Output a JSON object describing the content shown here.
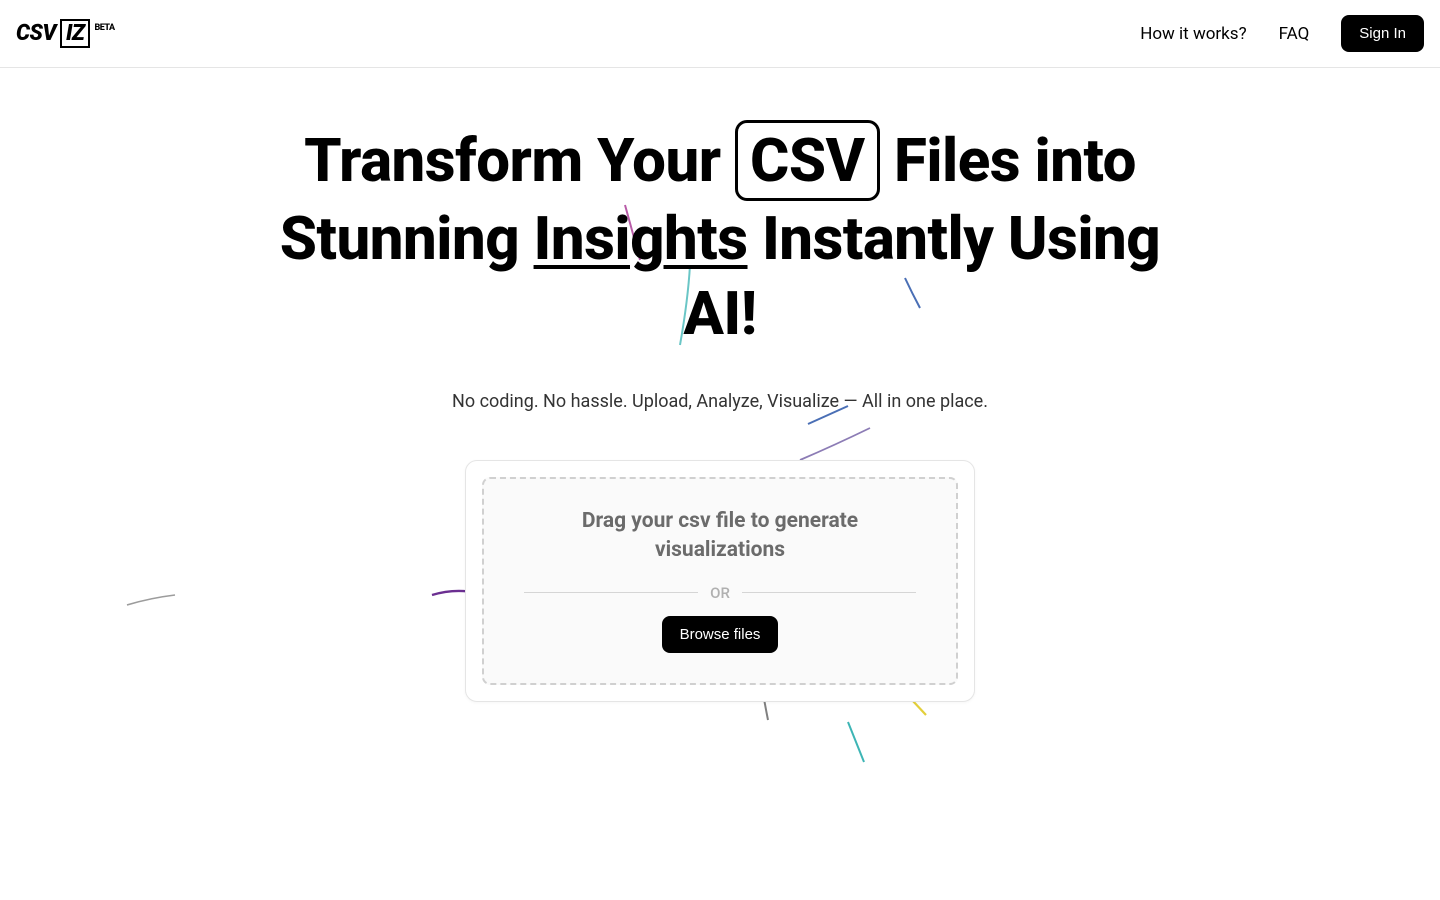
{
  "header": {
    "logo_csv": "CSV",
    "logo_iz": "IZ",
    "logo_beta": "BETA",
    "nav_how": "How it works?",
    "nav_faq": "FAQ",
    "signin": "Sign In"
  },
  "hero": {
    "h_part1": "Transform Your ",
    "h_csv": "CSV",
    "h_part2": " Files into Stunning ",
    "h_insights": "Insights",
    "h_part3": " Instantly Using AI!",
    "subtitle": "No coding. No hassle. Upload, Analyze, Visualize — All in one place."
  },
  "upload": {
    "title": "Drag your csv file to generate visualizations",
    "or": "OR",
    "browse": "Browse files"
  }
}
